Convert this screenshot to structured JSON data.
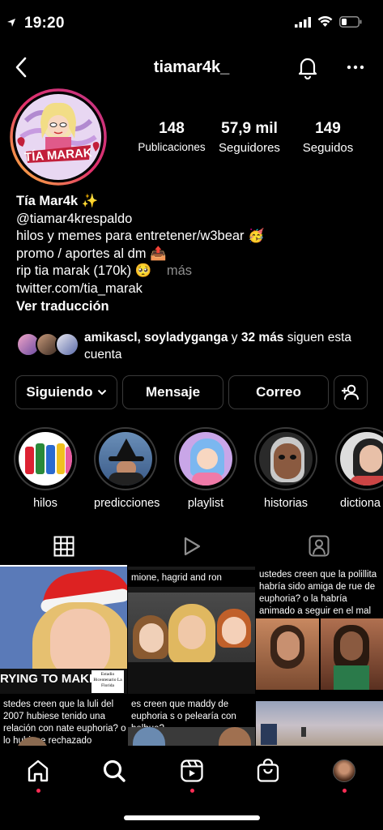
{
  "status_bar": {
    "time": "19:20"
  },
  "header": {
    "handle": "tiamar4k_"
  },
  "profile": {
    "avatar_text": "TÍA MARAK",
    "stats": [
      {
        "value": "148",
        "label": "Publicaciones"
      },
      {
        "value": "57,9 mil",
        "label": "Seguidores"
      },
      {
        "value": "149",
        "label": "Seguidos"
      }
    ]
  },
  "bio": {
    "name": "Tía Mar4k ✨",
    "lines": [
      "@tiamar4krespaldo",
      "hilos y memes para entretener/w3bear 🥳",
      "promo / aportes al dm 📤"
    ],
    "last_line": "rip tia marak (170k) 🥺",
    "more": "más",
    "link": "twitter.com/tia_marak",
    "translate": "Ver traducción"
  },
  "followers": {
    "names": "amikascl, soyladyganga",
    "joiner": " y ",
    "count": "32 más",
    "suffix": " siguen esta cuenta"
  },
  "buttons": {
    "following": "Siguiendo",
    "message": "Mensaje",
    "email": "Correo"
  },
  "highlights": [
    {
      "label": "hilos"
    },
    {
      "label": "predicciones"
    },
    {
      "label": "playlist"
    },
    {
      "label": "historias"
    },
    {
      "label": "dictiona"
    }
  ],
  "grid": {
    "post1_overlay": "RYING TO MAKE",
    "post1_stamp": "Estadio Bicentenario La Florida",
    "post2_caption": "mione, hagrid and ron",
    "post3_caption": "ustedes creen que la polillita habría sido amiga de rue de euphoria? o la habría animado a seguir en el mal camino?",
    "post4_caption": "stedes creen que la luli del 2007 hubiese tenido una relación con nate euphoria? o lo hubiese rechazado",
    "post5_caption": "es creen que maddy de euphoria s o pelearía con helhue?"
  },
  "colors": {
    "notification_dot": "#ff2d55",
    "button_border": "#3a3a3a",
    "muted_text": "#8e8e8e"
  }
}
